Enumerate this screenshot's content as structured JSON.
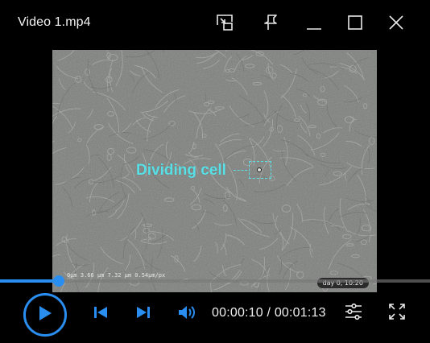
{
  "window": {
    "title": "Video 1.mp4"
  },
  "titlebar": {
    "buttons": [
      "picture-in-picture-icon",
      "pin-icon",
      "minimize-icon",
      "maximize-icon",
      "close-icon"
    ]
  },
  "video": {
    "annotation_label": "Dividing cell",
    "scalebar_text": "0µm   3.66 µm   7.32 µm   0.54µm/px",
    "timestamp_badge": "day 0, 10:20",
    "annotation_color": "#59e0e6"
  },
  "player": {
    "progress_fraction": 0.137,
    "current_time": "00:00:10",
    "separator": " / ",
    "total_time": "00:01:13",
    "accent_color": "#2a8ef0",
    "controls": [
      "play-icon",
      "skip-previous-icon",
      "skip-next-icon",
      "volume-icon",
      "settings-sliders-icon",
      "fullscreen-icon"
    ]
  }
}
